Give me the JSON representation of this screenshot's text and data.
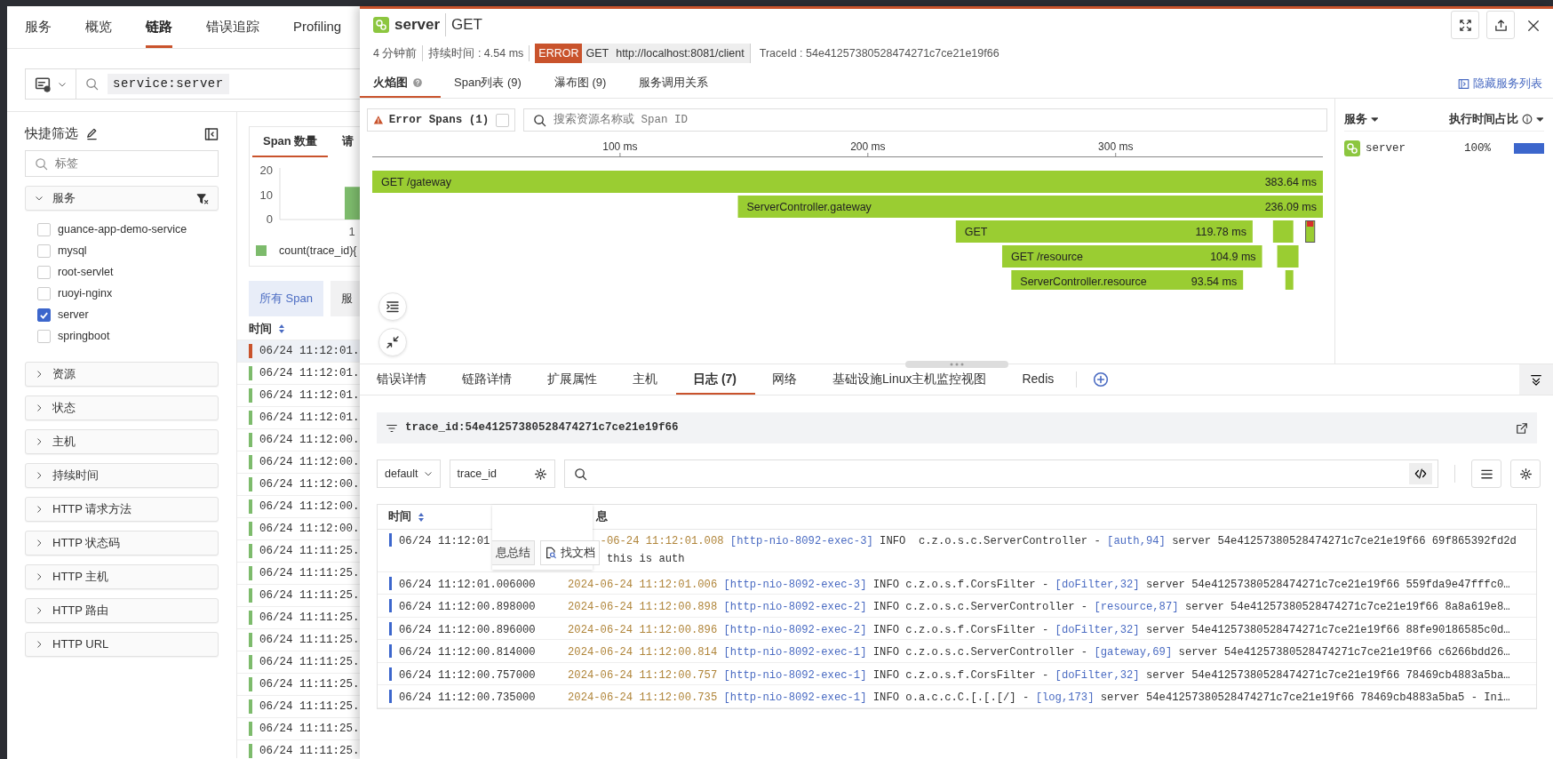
{
  "app_tabs": [
    {
      "label": "服务",
      "selected": false
    },
    {
      "label": "概览",
      "selected": false
    },
    {
      "label": "链路",
      "selected": true
    },
    {
      "label": "错误追踪",
      "selected": false
    },
    {
      "label": "Profiling",
      "selected": false
    }
  ],
  "query": {
    "chip": "service:server"
  },
  "quick_filter": {
    "title": "快捷筛选",
    "search_placeholder": "标签",
    "groups": [
      {
        "label": "服务",
        "expanded": true,
        "options": [
          {
            "label": "guance-app-demo-service",
            "checked": false
          },
          {
            "label": "mysql",
            "checked": false
          },
          {
            "label": "root-servlet",
            "checked": false
          },
          {
            "label": "ruoyi-nginx",
            "checked": false
          },
          {
            "label": "server",
            "checked": true
          },
          {
            "label": "springboot",
            "checked": false
          }
        ]
      },
      {
        "label": "资源",
        "expanded": false
      },
      {
        "label": "状态",
        "expanded": false
      },
      {
        "label": "主机",
        "expanded": false
      },
      {
        "label": "持续时间",
        "expanded": false
      },
      {
        "label": "HTTP 请求方法",
        "expanded": false
      },
      {
        "label": "HTTP 状态码",
        "expanded": false
      },
      {
        "label": "HTTP 主机",
        "expanded": false
      },
      {
        "label": "HTTP 路由",
        "expanded": false
      },
      {
        "label": "HTTP URL",
        "expanded": false
      }
    ]
  },
  "overview": {
    "tabs": [
      {
        "label": "Span 数量",
        "selected": true
      },
      {
        "label": "请",
        "selected": false
      }
    ],
    "chart_data": {
      "type": "bar",
      "ylim": [
        0,
        20
      ],
      "yticks": [
        0,
        10,
        20
      ],
      "categories": [
        "1"
      ],
      "series": [
        {
          "name": "count(trace_id){",
          "color": "#7dbb6c",
          "values": [
            13
          ]
        }
      ]
    }
  },
  "span_filters": [
    {
      "label": "所有 Span",
      "selected": true
    },
    {
      "label": "服",
      "selected": false
    }
  ],
  "span_table": {
    "columns": [
      "时间"
    ],
    "rows": [
      {
        "time": "06/24 11:12:01.",
        "color": "#c9532c",
        "selected": true
      },
      {
        "time": "06/24 11:12:01.",
        "color": "#7dbb6c",
        "selected": false
      },
      {
        "time": "06/24 11:12:01.",
        "color": "#7dbb6c",
        "selected": false
      },
      {
        "time": "06/24 11:12:01.",
        "color": "#7dbb6c",
        "selected": false
      },
      {
        "time": "06/24 11:12:00.",
        "color": "#7dbb6c",
        "selected": false
      },
      {
        "time": "06/24 11:12:00.",
        "color": "#7dbb6c",
        "selected": false
      },
      {
        "time": "06/24 11:12:00.",
        "color": "#7dbb6c",
        "selected": false
      },
      {
        "time": "06/24 11:12:00.",
        "color": "#7dbb6c",
        "selected": false
      },
      {
        "time": "06/24 11:12:00.",
        "color": "#7dbb6c",
        "selected": false
      },
      {
        "time": "06/24 11:11:25.",
        "color": "#7dbb6c",
        "selected": false
      },
      {
        "time": "06/24 11:11:25.",
        "color": "#7dbb6c",
        "selected": false
      },
      {
        "time": "06/24 11:11:25.",
        "color": "#7dbb6c",
        "selected": false
      },
      {
        "time": "06/24 11:11:25.",
        "color": "#7dbb6c",
        "selected": false
      },
      {
        "time": "06/24 11:11:25.",
        "color": "#7dbb6c",
        "selected": false
      },
      {
        "time": "06/24 11:11:25.",
        "color": "#7dbb6c",
        "selected": false
      },
      {
        "time": "06/24 11:11:25.",
        "color": "#7dbb6c",
        "selected": false
      },
      {
        "time": "06/24 11:11:25.",
        "color": "#7dbb6c",
        "selected": false
      },
      {
        "time": "06/24 11:11:25.",
        "color": "#7dbb6c",
        "selected": false
      },
      {
        "time": "06/24 11:11:25.",
        "color": "#7dbb6c",
        "selected": false
      }
    ]
  },
  "drawer": {
    "service": "server",
    "title": "GET",
    "age": "4 分钟前",
    "duration": "持续时间 : 4.54 ms",
    "status": "ERROR",
    "method": "GET",
    "url": "http://localhost:8081/client",
    "trace": "TraceId : 54e41257380528474271c7ce21e19f66",
    "tabs": [
      {
        "label": "火焰图",
        "selected": true
      },
      {
        "label": "Span列表 (9)",
        "selected": false
      },
      {
        "label": "瀑布图 (9)",
        "selected": false
      },
      {
        "label": "服务调用关系",
        "selected": false
      }
    ],
    "hide_services": "隐藏服务列表",
    "flame": {
      "error_filter": {
        "label": "Error Spans (1)",
        "checked": false
      },
      "search_placeholder": "搜索资源名称或 Span ID",
      "ticks": [
        "100 ms",
        "200 ms",
        "300 ms"
      ],
      "spans": [
        {
          "name": "GET /gateway",
          "duration": "383.64 ms"
        },
        {
          "name": "ServerController.gateway",
          "duration": "236.09 ms"
        },
        {
          "name": "GET",
          "duration": "119.78 ms"
        },
        {
          "name": "GET /resource",
          "duration": "104.9 ms"
        },
        {
          "name": "ServerController.resource",
          "duration": "93.54 ms"
        }
      ],
      "minor_spans": [
        {
          "error": false
        },
        {
          "error": true
        },
        {
          "error": false
        },
        {
          "error": false
        }
      ]
    },
    "services": {
      "columns": [
        "服务",
        "执行时间占比"
      ],
      "rows": [
        {
          "name": "server",
          "share": "100%",
          "level": 1
        }
      ]
    },
    "detail_tabs": [
      {
        "label": "错误详情",
        "selected": false
      },
      {
        "label": "链路详情",
        "selected": false
      },
      {
        "label": "扩展属性",
        "selected": false
      },
      {
        "label": "主机",
        "selected": false
      },
      {
        "label": "日志 (7)",
        "selected": true
      },
      {
        "label": "网络",
        "selected": false
      },
      {
        "label": "基础设施Linux主机监控视图",
        "selected": false
      },
      {
        "label": "Redis",
        "selected": false
      }
    ],
    "log_filter": "trace_id:54e41257380528474271c7ce21e19f66",
    "index": "default",
    "field": "trace_id",
    "logs": {
      "columns": [
        "时间",
        "息"
      ],
      "rows": [
        {
          "time": "06/24 11:12:01",
          "parts": [
            {
              "kind": "date",
              "text": "-06-24 11:12:01.008"
            },
            {
              "kind": "link",
              "text": "[http-nio-8092-exec-3]"
            },
            {
              "kind": "text",
              "text": "INFO  c.z.o.s.c.ServerController -"
            },
            {
              "kind": "link",
              "text": "[auth,94]"
            },
            {
              "kind": "text",
              "text": "server 54e41257380528474271c7ce21e19f66 69f865392fd2d"
            }
          ],
          "continuation": "this is auth"
        },
        {
          "time": "06/24 11:12:01.006000",
          "parts": [
            {
              "kind": "date",
              "text": "2024-06-24 11:12:01.006"
            },
            {
              "kind": "link",
              "text": "[http-nio-8092-exec-3]"
            },
            {
              "kind": "text",
              "text": "INFO c.z.o.s.f.CorsFilter -"
            },
            {
              "kind": "link",
              "text": "[doFilter,32]"
            },
            {
              "kind": "text",
              "text": "server 54e41257380528474271c7ce21e19f66 559fda9e47fffc0…"
            }
          ]
        },
        {
          "time": "06/24 11:12:00.898000",
          "parts": [
            {
              "kind": "date",
              "text": "2024-06-24 11:12:00.898"
            },
            {
              "kind": "link",
              "text": "[http-nio-8092-exec-2]"
            },
            {
              "kind": "text",
              "text": "INFO c.z.o.s.c.ServerController -"
            },
            {
              "kind": "link",
              "text": "[resource,87]"
            },
            {
              "kind": "text",
              "text": "server 54e41257380528474271c7ce21e19f66 8a8a619e8…"
            }
          ]
        },
        {
          "time": "06/24 11:12:00.896000",
          "parts": [
            {
              "kind": "date",
              "text": "2024-06-24 11:12:00.896"
            },
            {
              "kind": "link",
              "text": "[http-nio-8092-exec-2]"
            },
            {
              "kind": "text",
              "text": "INFO c.z.o.s.f.CorsFilter -"
            },
            {
              "kind": "link",
              "text": "[doFilter,32]"
            },
            {
              "kind": "text",
              "text": "server 54e41257380528474271c7ce21e19f66 88fe90186585c0d…"
            }
          ]
        },
        {
          "time": "06/24 11:12:00.814000",
          "parts": [
            {
              "kind": "date",
              "text": "2024-06-24 11:12:00.814"
            },
            {
              "kind": "link",
              "text": "[http-nio-8092-exec-1]"
            },
            {
              "kind": "text",
              "text": "INFO c.z.o.s.c.ServerController -"
            },
            {
              "kind": "link",
              "text": "[gateway,69]"
            },
            {
              "kind": "text",
              "text": "server 54e41257380528474271c7ce21e19f66 c6266bdd26…"
            }
          ]
        },
        {
          "time": "06/24 11:12:00.757000",
          "parts": [
            {
              "kind": "date",
              "text": "2024-06-24 11:12:00.757"
            },
            {
              "kind": "link",
              "text": "[http-nio-8092-exec-1]"
            },
            {
              "kind": "text",
              "text": "INFO c.z.o.s.f.CorsFilter -"
            },
            {
              "kind": "link",
              "text": "[doFilter,32]"
            },
            {
              "kind": "text",
              "text": "server 54e41257380528474271c7ce21e19f66 78469cb4883a5ba…"
            }
          ]
        },
        {
          "time": "06/24 11:12:00.735000",
          "parts": [
            {
              "kind": "date",
              "text": "2024-06-24 11:12:00.735"
            },
            {
              "kind": "link",
              "text": "[http-nio-8092-exec-1]"
            },
            {
              "kind": "text",
              "text": "INFO o.a.c.c.C.[.[.[/] -"
            },
            {
              "kind": "link",
              "text": "[log,173]"
            },
            {
              "kind": "text",
              "text": "server 54e41257380528474271c7ce21e19f66 78469cb4883a5ba5 - Ini…"
            }
          ]
        }
      ]
    },
    "popover": {
      "buttons": [
        "息总结",
        "找文档"
      ]
    }
  }
}
